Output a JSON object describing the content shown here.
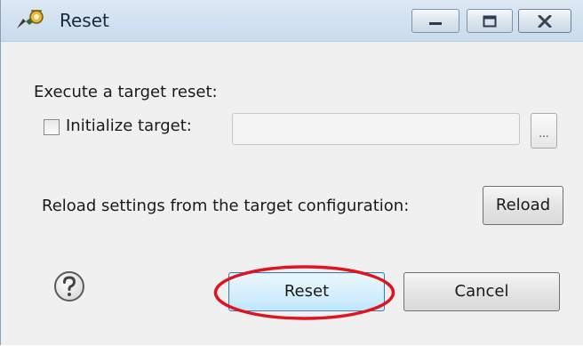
{
  "window": {
    "title": "Reset",
    "icon": "target-connection-icon",
    "controls": [
      "minimize-icon",
      "maximize-icon",
      "close-icon"
    ]
  },
  "execute_label": "Execute a target reset:",
  "initialize": {
    "label": "Initialize target:",
    "checked": false,
    "value": "",
    "browse_label": "..."
  },
  "reload": {
    "label": "Reload settings from the target configuration:",
    "button_label": "Reload"
  },
  "buttons": {
    "help_icon": "help-icon",
    "reset_label": "Reset",
    "cancel_label": "Cancel"
  },
  "colors": {
    "highlight": "#e0141e",
    "default_button": "#bee6fd",
    "titlebar": "#d2e1f0"
  }
}
